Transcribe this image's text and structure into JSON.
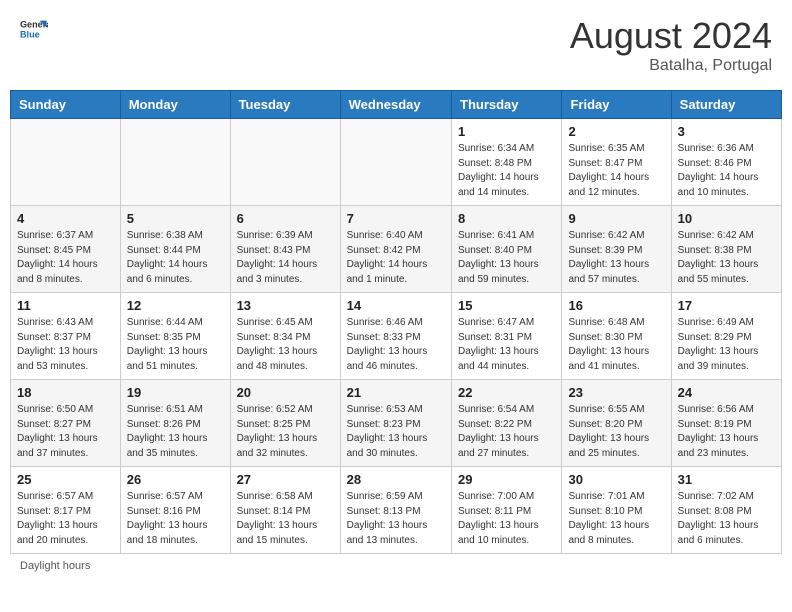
{
  "header": {
    "logo_general": "General",
    "logo_blue": "Blue",
    "month_year": "August 2024",
    "location": "Batalha, Portugal"
  },
  "days_of_week": [
    "Sunday",
    "Monday",
    "Tuesday",
    "Wednesday",
    "Thursday",
    "Friday",
    "Saturday"
  ],
  "weeks": [
    [
      {
        "day": "",
        "sunrise": "",
        "sunset": "",
        "daylight": ""
      },
      {
        "day": "",
        "sunrise": "",
        "sunset": "",
        "daylight": ""
      },
      {
        "day": "",
        "sunrise": "",
        "sunset": "",
        "daylight": ""
      },
      {
        "day": "",
        "sunrise": "",
        "sunset": "",
        "daylight": ""
      },
      {
        "day": "1",
        "sunrise": "Sunrise: 6:34 AM",
        "sunset": "Sunset: 8:48 PM",
        "daylight": "Daylight: 14 hours and 14 minutes."
      },
      {
        "day": "2",
        "sunrise": "Sunrise: 6:35 AM",
        "sunset": "Sunset: 8:47 PM",
        "daylight": "Daylight: 14 hours and 12 minutes."
      },
      {
        "day": "3",
        "sunrise": "Sunrise: 6:36 AM",
        "sunset": "Sunset: 8:46 PM",
        "daylight": "Daylight: 14 hours and 10 minutes."
      }
    ],
    [
      {
        "day": "4",
        "sunrise": "Sunrise: 6:37 AM",
        "sunset": "Sunset: 8:45 PM",
        "daylight": "Daylight: 14 hours and 8 minutes."
      },
      {
        "day": "5",
        "sunrise": "Sunrise: 6:38 AM",
        "sunset": "Sunset: 8:44 PM",
        "daylight": "Daylight: 14 hours and 6 minutes."
      },
      {
        "day": "6",
        "sunrise": "Sunrise: 6:39 AM",
        "sunset": "Sunset: 8:43 PM",
        "daylight": "Daylight: 14 hours and 3 minutes."
      },
      {
        "day": "7",
        "sunrise": "Sunrise: 6:40 AM",
        "sunset": "Sunset: 8:42 PM",
        "daylight": "Daylight: 14 hours and 1 minute."
      },
      {
        "day": "8",
        "sunrise": "Sunrise: 6:41 AM",
        "sunset": "Sunset: 8:40 PM",
        "daylight": "Daylight: 13 hours and 59 minutes."
      },
      {
        "day": "9",
        "sunrise": "Sunrise: 6:42 AM",
        "sunset": "Sunset: 8:39 PM",
        "daylight": "Daylight: 13 hours and 57 minutes."
      },
      {
        "day": "10",
        "sunrise": "Sunrise: 6:42 AM",
        "sunset": "Sunset: 8:38 PM",
        "daylight": "Daylight: 13 hours and 55 minutes."
      }
    ],
    [
      {
        "day": "11",
        "sunrise": "Sunrise: 6:43 AM",
        "sunset": "Sunset: 8:37 PM",
        "daylight": "Daylight: 13 hours and 53 minutes."
      },
      {
        "day": "12",
        "sunrise": "Sunrise: 6:44 AM",
        "sunset": "Sunset: 8:35 PM",
        "daylight": "Daylight: 13 hours and 51 minutes."
      },
      {
        "day": "13",
        "sunrise": "Sunrise: 6:45 AM",
        "sunset": "Sunset: 8:34 PM",
        "daylight": "Daylight: 13 hours and 48 minutes."
      },
      {
        "day": "14",
        "sunrise": "Sunrise: 6:46 AM",
        "sunset": "Sunset: 8:33 PM",
        "daylight": "Daylight: 13 hours and 46 minutes."
      },
      {
        "day": "15",
        "sunrise": "Sunrise: 6:47 AM",
        "sunset": "Sunset: 8:31 PM",
        "daylight": "Daylight: 13 hours and 44 minutes."
      },
      {
        "day": "16",
        "sunrise": "Sunrise: 6:48 AM",
        "sunset": "Sunset: 8:30 PM",
        "daylight": "Daylight: 13 hours and 41 minutes."
      },
      {
        "day": "17",
        "sunrise": "Sunrise: 6:49 AM",
        "sunset": "Sunset: 8:29 PM",
        "daylight": "Daylight: 13 hours and 39 minutes."
      }
    ],
    [
      {
        "day": "18",
        "sunrise": "Sunrise: 6:50 AM",
        "sunset": "Sunset: 8:27 PM",
        "daylight": "Daylight: 13 hours and 37 minutes."
      },
      {
        "day": "19",
        "sunrise": "Sunrise: 6:51 AM",
        "sunset": "Sunset: 8:26 PM",
        "daylight": "Daylight: 13 hours and 35 minutes."
      },
      {
        "day": "20",
        "sunrise": "Sunrise: 6:52 AM",
        "sunset": "Sunset: 8:25 PM",
        "daylight": "Daylight: 13 hours and 32 minutes."
      },
      {
        "day": "21",
        "sunrise": "Sunrise: 6:53 AM",
        "sunset": "Sunset: 8:23 PM",
        "daylight": "Daylight: 13 hours and 30 minutes."
      },
      {
        "day": "22",
        "sunrise": "Sunrise: 6:54 AM",
        "sunset": "Sunset: 8:22 PM",
        "daylight": "Daylight: 13 hours and 27 minutes."
      },
      {
        "day": "23",
        "sunrise": "Sunrise: 6:55 AM",
        "sunset": "Sunset: 8:20 PM",
        "daylight": "Daylight: 13 hours and 25 minutes."
      },
      {
        "day": "24",
        "sunrise": "Sunrise: 6:56 AM",
        "sunset": "Sunset: 8:19 PM",
        "daylight": "Daylight: 13 hours and 23 minutes."
      }
    ],
    [
      {
        "day": "25",
        "sunrise": "Sunrise: 6:57 AM",
        "sunset": "Sunset: 8:17 PM",
        "daylight": "Daylight: 13 hours and 20 minutes."
      },
      {
        "day": "26",
        "sunrise": "Sunrise: 6:57 AM",
        "sunset": "Sunset: 8:16 PM",
        "daylight": "Daylight: 13 hours and 18 minutes."
      },
      {
        "day": "27",
        "sunrise": "Sunrise: 6:58 AM",
        "sunset": "Sunset: 8:14 PM",
        "daylight": "Daylight: 13 hours and 15 minutes."
      },
      {
        "day": "28",
        "sunrise": "Sunrise: 6:59 AM",
        "sunset": "Sunset: 8:13 PM",
        "daylight": "Daylight: 13 hours and 13 minutes."
      },
      {
        "day": "29",
        "sunrise": "Sunrise: 7:00 AM",
        "sunset": "Sunset: 8:11 PM",
        "daylight": "Daylight: 13 hours and 10 minutes."
      },
      {
        "day": "30",
        "sunrise": "Sunrise: 7:01 AM",
        "sunset": "Sunset: 8:10 PM",
        "daylight": "Daylight: 13 hours and 8 minutes."
      },
      {
        "day": "31",
        "sunrise": "Sunrise: 7:02 AM",
        "sunset": "Sunset: 8:08 PM",
        "daylight": "Daylight: 13 hours and 6 minutes."
      }
    ]
  ],
  "footer": {
    "note": "Daylight hours"
  }
}
